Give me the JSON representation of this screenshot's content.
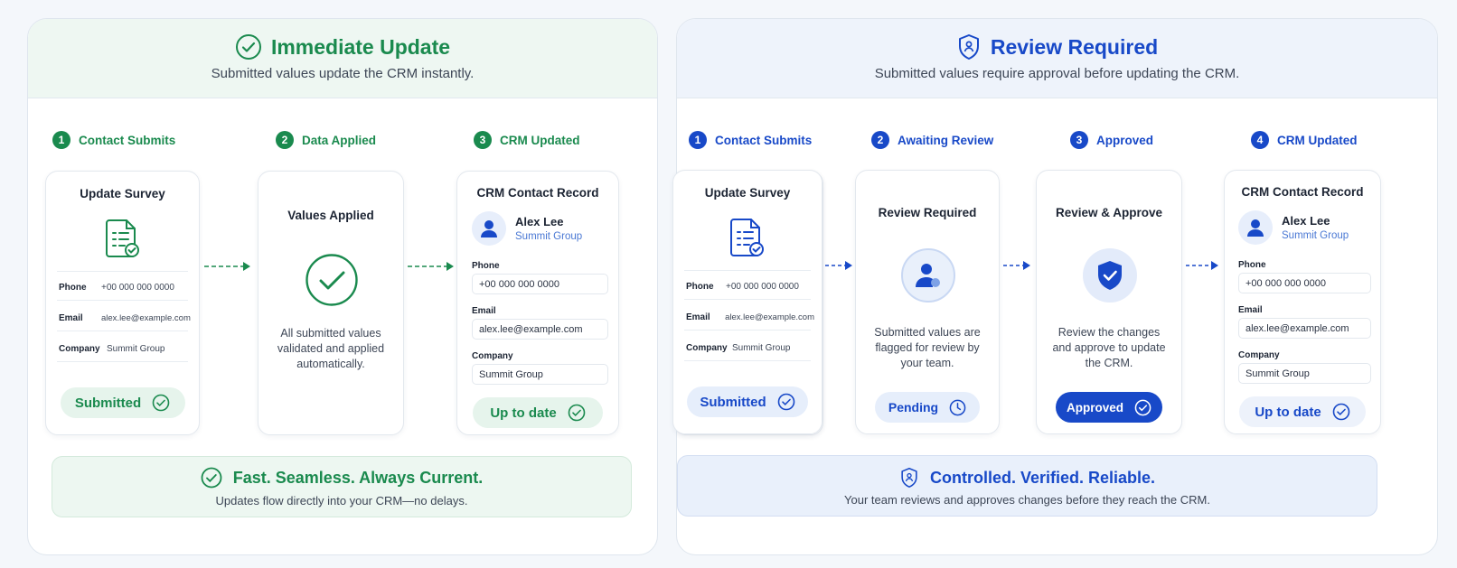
{
  "colors": {
    "green": "#1a8a4e",
    "blue": "#1849c8"
  },
  "immediate": {
    "title": "Immediate Update",
    "subtitle": "Submitted values update the CRM instantly.",
    "steps": [
      {
        "num": "1",
        "label": "Contact Submits"
      },
      {
        "num": "2",
        "label": "Data Applied"
      },
      {
        "num": "3",
        "label": "CRM Updated"
      }
    ],
    "survey": {
      "title": "Update Survey",
      "phone_label": "Phone",
      "phone": "+00 000 000 0000",
      "email_label": "Email",
      "email": "alex.lee@example.com",
      "company_label": "Company",
      "company": "Summit Group",
      "status": "Submitted"
    },
    "applied": {
      "title": "Values Applied",
      "desc": "All submitted values validated and applied automatically."
    },
    "crm": {
      "title": "CRM Contact Record",
      "name": "Alex Lee",
      "company_name": "Summit Group",
      "phone_label": "Phone",
      "phone": "+00 000 000 0000",
      "email_label": "Email",
      "email": "alex.lee@example.com",
      "company_label": "Company",
      "company": "Summit Group",
      "status": "Up to date"
    },
    "banner": {
      "title": "Fast. Seamless. Always Current.",
      "subtitle": "Updates flow directly into your CRM—no delays."
    }
  },
  "review": {
    "title": "Review Required",
    "subtitle": "Submitted values require approval before updating the CRM.",
    "steps": [
      {
        "num": "1",
        "label": "Contact Submits"
      },
      {
        "num": "2",
        "label": "Awaiting Review"
      },
      {
        "num": "3",
        "label": "Approved"
      },
      {
        "num": "4",
        "label": "CRM Updated"
      }
    ],
    "survey": {
      "title": "Update Survey",
      "phone_label": "Phone",
      "phone": "+00 000 000 0000",
      "email_label": "Email",
      "email": "alex.lee@example.com",
      "company_label": "Company",
      "company": "Summit Group",
      "status": "Submitted"
    },
    "pending": {
      "title": "Review Required",
      "desc": "Submitted values are flagged for review by your team.",
      "status": "Pending"
    },
    "approve": {
      "title": "Review & Approve",
      "desc": "Review the changes and approve to update the CRM.",
      "status": "Approved"
    },
    "crm": {
      "title": "CRM Contact Record",
      "name": "Alex Lee",
      "company_name": "Summit Group",
      "phone_label": "Phone",
      "phone": "+00 000 000 0000",
      "email_label": "Email",
      "email": "alex.lee@example.com",
      "company_label": "Company",
      "company": "Summit Group",
      "status": "Up to date"
    },
    "banner": {
      "title": "Controlled. Verified. Reliable.",
      "subtitle": "Your team reviews and approves changes before they reach the CRM."
    }
  }
}
